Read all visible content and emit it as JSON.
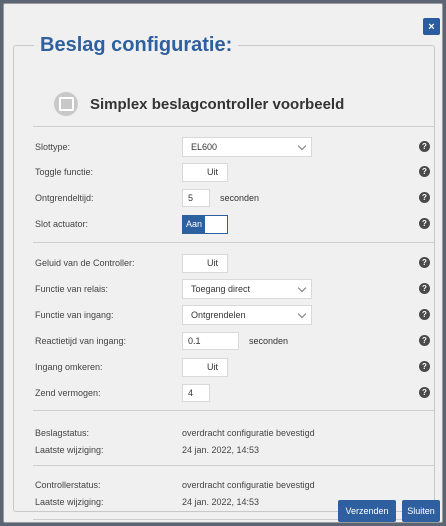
{
  "dialog": {
    "legend": "Beslag configuratie:",
    "title": "Simplex beslagcontroller voorbeeld",
    "close_label": "×"
  },
  "fields": {
    "sloттype": null,
    "slottype": {
      "label": "Slottype:",
      "value": "EL600"
    },
    "toggle_functie": {
      "label": "Toggle functie:",
      "value": "Uit"
    },
    "ontgrendeltijd": {
      "label": "Ontgrendeltijd:",
      "value": "5",
      "unit": "seconden"
    },
    "slot_actuator": {
      "label": "Slot actuator:",
      "value": "Aan"
    },
    "geluid": {
      "label": "Geluid van de Controller:",
      "value": "Uit"
    },
    "functie_relais": {
      "label": "Functie van relais:",
      "value": "Toegang direct"
    },
    "functie_ingang": {
      "label": "Functie van ingang:",
      "value": "Ontgrendelen"
    },
    "reactietijd": {
      "label": "Reactietijd van ingang:",
      "value": "0.1",
      "unit": "seconden"
    },
    "ingang_omkeren": {
      "label": "Ingang omkeren:",
      "value": "Uit"
    },
    "zend_vermogen": {
      "label": "Zend vermogen:",
      "value": "4"
    }
  },
  "status": {
    "beslag": {
      "label": "Beslagstatus:",
      "value": "overdracht configuratie bevestigd"
    },
    "beslag_wijziging": {
      "label": "Laatste wijziging:",
      "value": "24 jan. 2022, 14:53"
    },
    "controller": {
      "label": "Controllerstatus:",
      "value": "overdracht configuratie bevestigd"
    },
    "controller_wijziging": {
      "label": "Laatste wijziging:",
      "value": "24 jan. 2022, 14:53"
    }
  },
  "buttons": {
    "send": "Verzenden",
    "close": "Sluiten"
  },
  "help_glyph": "?",
  "colors": {
    "accent": "#2e5f9e",
    "backdrop": "#5c6573",
    "panel": "#f0f0f0"
  }
}
